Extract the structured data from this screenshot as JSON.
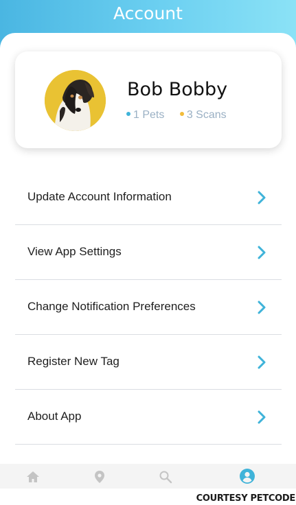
{
  "header": {
    "title": "Account"
  },
  "profile": {
    "name": "Bob Bobby",
    "pets": "1 Pets",
    "scans": "3 Scans",
    "avatar_icon": "dog-photo"
  },
  "menu": {
    "items": [
      {
        "label": "Update Account Information"
      },
      {
        "label": "View App Settings"
      },
      {
        "label": "Change Notification Preferences"
      },
      {
        "label": "Register New Tag"
      },
      {
        "label": "About App"
      },
      {
        "label": ""
      }
    ]
  },
  "bottom_nav": {
    "items": [
      {
        "icon": "home-icon",
        "active": false
      },
      {
        "icon": "location-pin-icon",
        "active": false
      },
      {
        "icon": "search-icon",
        "active": false
      },
      {
        "icon": "account-icon",
        "active": true
      }
    ]
  },
  "caption": "COURTESY PETCODE",
  "colors": {
    "accent": "#3fb3d9",
    "scans_dot": "#f2bc3a",
    "header_start": "#4ab6e2",
    "header_end": "#8be2f6",
    "inactive_icon": "#c4c4c4"
  }
}
